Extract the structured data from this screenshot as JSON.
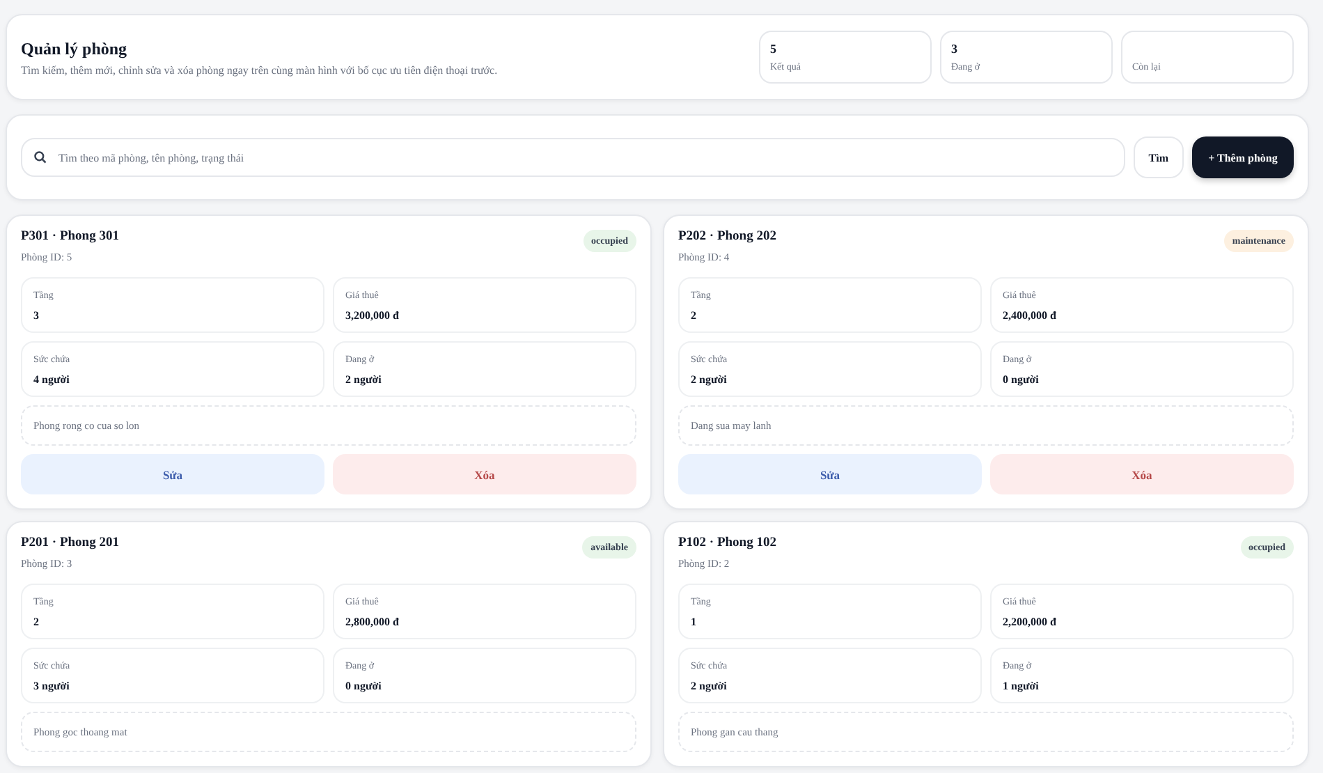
{
  "header": {
    "title": "Quản lý phòng",
    "subtitle": "Tìm kiếm, thêm mới, chỉnh sửa và xóa phòng ngay trên cùng màn hình với bố cục ưu tiên điện thoại trước.",
    "stats": [
      {
        "value": "5",
        "label": "Kết quả"
      },
      {
        "value": "3",
        "label": "Đang ở"
      },
      {
        "label": "Còn lại"
      }
    ]
  },
  "search": {
    "placeholder": "Tìm theo mã phòng, tên phòng, trạng thái",
    "search_button": "Tìm",
    "add_button": "+ Thêm phòng"
  },
  "rooms": [
    {
      "title": "P301 · Phong 301",
      "id": "Phòng ID: 5",
      "status": "occupied",
      "color": "#e8f5e9",
      "fields": [
        {
          "label": "Tầng",
          "value": "3"
        },
        {
          "label": "Giá thuê",
          "value": "3,200,000 đ"
        },
        {
          "label": "Sức chứa",
          "value": "4 người"
        },
        {
          "label": "Đang ở",
          "value": "2 người"
        }
      ],
      "note": "Phong rong co cua so lon",
      "edit": "Sửa",
      "delete": "Xóa"
    },
    {
      "title": "P202 · Phong 202",
      "id": "Phòng ID: 4",
      "status": "maintenance",
      "color": "#fdf0e0",
      "fields": [
        {
          "label": "Tầng",
          "value": "2"
        },
        {
          "label": "Giá thuê",
          "value": "2,400,000 đ"
        },
        {
          "label": "Sức chứa",
          "value": "2 người"
        },
        {
          "label": "Đang ở",
          "value": "0 người"
        }
      ],
      "note": "Dang sua may lanh",
      "edit": "Sửa",
      "delete": "Xóa"
    },
    {
      "title": "P201 · Phong 201",
      "id": "Phòng ID: 3",
      "status": "available",
      "color": "#e8f5e9",
      "fields": [
        {
          "label": "Tầng",
          "value": "2"
        },
        {
          "label": "Giá thuê",
          "value": "2,800,000 đ"
        },
        {
          "label": "Sức chứa",
          "value": "3 người"
        },
        {
          "label": "Đang ở",
          "value": "0 người"
        }
      ],
      "note": "Phong goc thoang mat"
    },
    {
      "title": "P102 · Phong 102",
      "id": "Phòng ID: 2",
      "status": "occupied",
      "color": "#e8f5e9",
      "fields": [
        {
          "label": "Tầng",
          "value": "1"
        },
        {
          "label": "Giá thuê",
          "value": "2,200,000 đ"
        },
        {
          "label": "Sức chứa",
          "value": "2 người"
        },
        {
          "label": "Đang ở",
          "value": "1 người"
        }
      ],
      "note": "Phong gan cau thang"
    }
  ]
}
